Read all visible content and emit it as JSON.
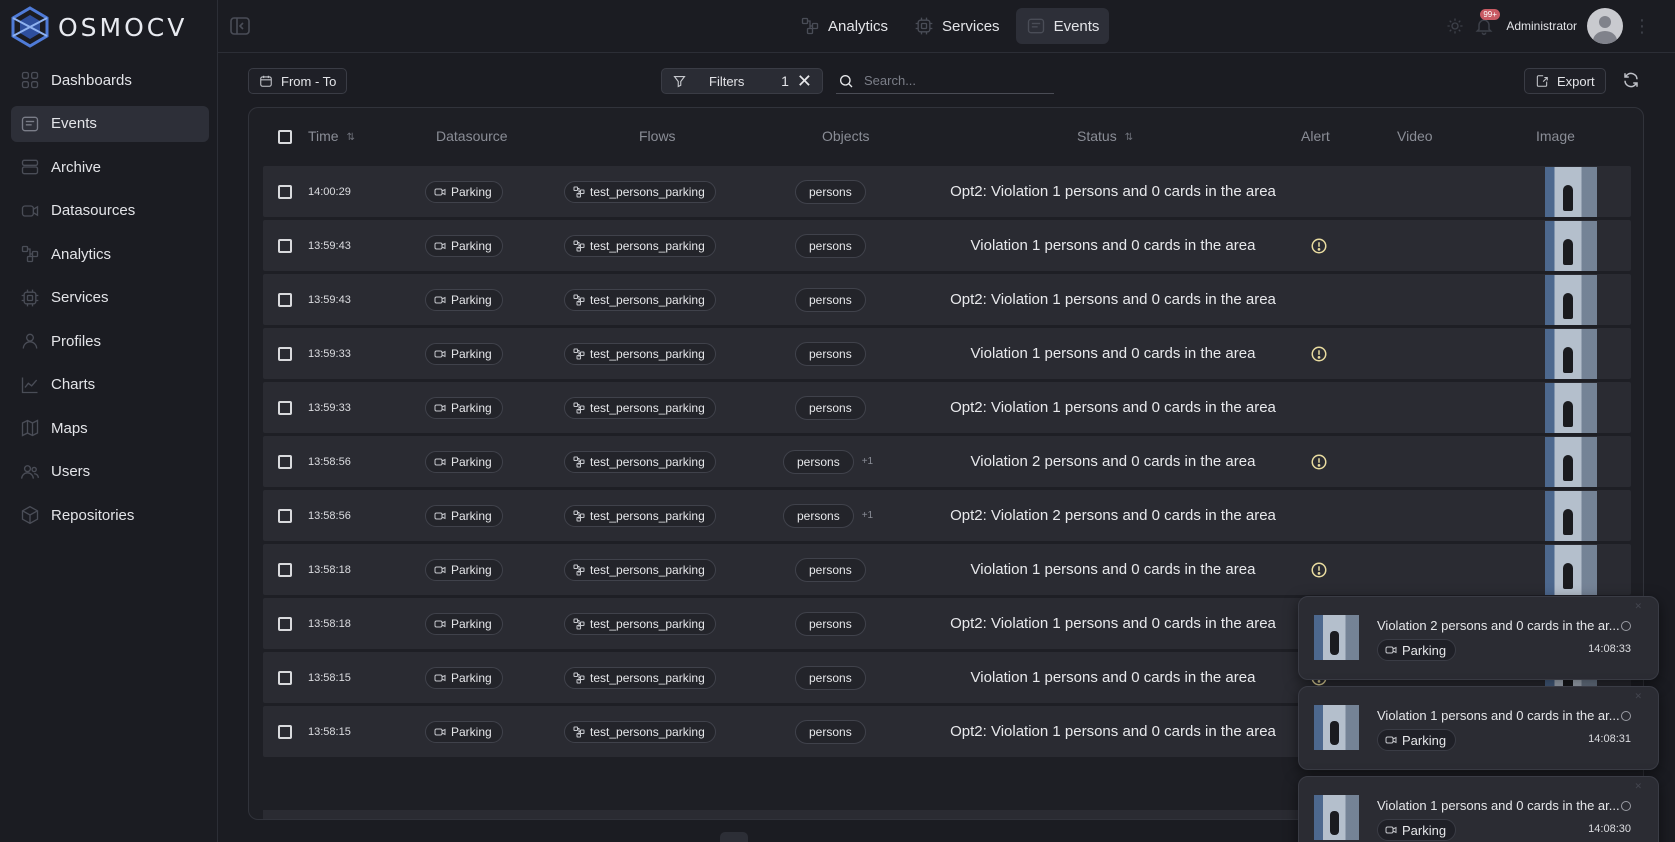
{
  "brand": {
    "name": "OSMOCV"
  },
  "sidebar": {
    "items": [
      {
        "label": "Dashboards",
        "icon": "dashboard-icon",
        "active": false
      },
      {
        "label": "Events",
        "icon": "events-icon",
        "active": true
      },
      {
        "label": "Archive",
        "icon": "archive-icon",
        "active": false
      },
      {
        "label": "Datasources",
        "icon": "datasource-icon",
        "active": false
      },
      {
        "label": "Analytics",
        "icon": "analytics-icon",
        "active": false
      },
      {
        "label": "Services",
        "icon": "services-icon",
        "active": false
      },
      {
        "label": "Profiles",
        "icon": "profile-icon",
        "active": false
      },
      {
        "label": "Charts",
        "icon": "chart-icon",
        "active": false
      },
      {
        "label": "Maps",
        "icon": "map-icon",
        "active": false
      },
      {
        "label": "Users",
        "icon": "users-icon",
        "active": false
      },
      {
        "label": "Repositories",
        "icon": "repository-icon",
        "active": false
      }
    ]
  },
  "topbar": {
    "tabs": [
      {
        "label": "Analytics",
        "icon": "analytics-icon",
        "active": false
      },
      {
        "label": "Services",
        "icon": "services-icon",
        "active": false
      },
      {
        "label": "Events",
        "icon": "events-icon",
        "active": true
      }
    ],
    "notification_badge": "99+",
    "user_name": "Administrator"
  },
  "toolbar": {
    "date_range_label": "From - To",
    "filters_label": "Filters",
    "filters_count": "1",
    "search_placeholder": "Search...",
    "export_label": "Export"
  },
  "table": {
    "columns": {
      "time": "Time",
      "datasource": "Datasource",
      "flows": "Flows",
      "objects": "Objects",
      "status": "Status",
      "alert": "Alert",
      "video": "Video",
      "image": "Image"
    },
    "rows": [
      {
        "time": "14:00:29",
        "datasource": "Parking",
        "flow": "test_persons_parking",
        "object": "persons",
        "more": "",
        "status": "Opt2: Violation 1 persons and 0 cards in the area",
        "alert": false
      },
      {
        "time": "13:59:43",
        "datasource": "Parking",
        "flow": "test_persons_parking",
        "object": "persons",
        "more": "",
        "status": "Violation 1 persons and 0 cards in the area",
        "alert": true
      },
      {
        "time": "13:59:43",
        "datasource": "Parking",
        "flow": "test_persons_parking",
        "object": "persons",
        "more": "",
        "status": "Opt2: Violation 1 persons and 0 cards in the area",
        "alert": false
      },
      {
        "time": "13:59:33",
        "datasource": "Parking",
        "flow": "test_persons_parking",
        "object": "persons",
        "more": "",
        "status": "Violation 1 persons and 0 cards in the area",
        "alert": true
      },
      {
        "time": "13:59:33",
        "datasource": "Parking",
        "flow": "test_persons_parking",
        "object": "persons",
        "more": "",
        "status": "Opt2: Violation 1 persons and 0 cards in the area",
        "alert": false
      },
      {
        "time": "13:58:56",
        "datasource": "Parking",
        "flow": "test_persons_parking",
        "object": "persons",
        "more": "+1",
        "status": "Violation 2 persons and 0 cards in the area",
        "alert": true
      },
      {
        "time": "13:58:56",
        "datasource": "Parking",
        "flow": "test_persons_parking",
        "object": "persons",
        "more": "+1",
        "status": "Opt2: Violation 2 persons and 0 cards in the area",
        "alert": false
      },
      {
        "time": "13:58:18",
        "datasource": "Parking",
        "flow": "test_persons_parking",
        "object": "persons",
        "more": "",
        "status": "Violation 1 persons and 0 cards in the area",
        "alert": true
      },
      {
        "time": "13:58:18",
        "datasource": "Parking",
        "flow": "test_persons_parking",
        "object": "persons",
        "more": "",
        "status": "Opt2: Violation 1 persons and 0 cards in the area",
        "alert": false
      },
      {
        "time": "13:58:15",
        "datasource": "Parking",
        "flow": "test_persons_parking",
        "object": "persons",
        "more": "",
        "status": "Violation 1 persons and 0 cards in the area",
        "alert": true
      },
      {
        "time": "13:58:15",
        "datasource": "Parking",
        "flow": "test_persons_parking",
        "object": "persons",
        "more": "",
        "status": "Opt2: Violation 1 persons and 0 cards in the area",
        "alert": false
      }
    ]
  },
  "notifications": [
    {
      "title": "Violation 2 persons and 0 cards in the ar...",
      "datasource": "Parking",
      "time": "14:08:33"
    },
    {
      "title": "Violation 1 persons and 0 cards in the ar...",
      "datasource": "Parking",
      "time": "14:08:31"
    },
    {
      "title": "Violation 1 persons and 0 cards in the ar...",
      "datasource": "Parking",
      "time": "14:08:30"
    }
  ],
  "colors": {
    "background": "#1b1c22",
    "row": "#2a2b32",
    "alert": "#e9dca0",
    "badge": "#c85a63"
  }
}
